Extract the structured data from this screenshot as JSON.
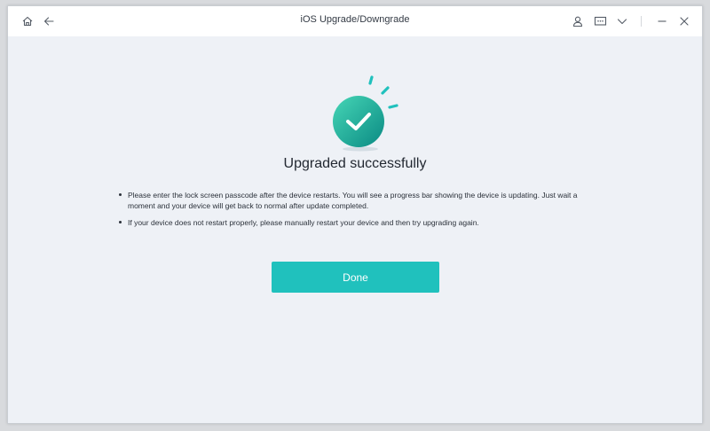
{
  "window": {
    "title": "iOS Upgrade/Downgrade"
  },
  "titlebar": {
    "left_icons": [
      "home-icon",
      "back-arrow-icon"
    ],
    "right_icons": [
      "user-icon",
      "feedback-icon",
      "chevron-down-icon",
      "minimize-icon",
      "close-icon"
    ]
  },
  "result": {
    "icon": "checkmark-icon",
    "heading": "Upgraded successfully",
    "notes": [
      "Please enter the lock screen passcode after the device restarts. You will see a progress bar showing the device is updating. Just wait a moment and your device will get back to normal after update completed.",
      "If your device does not restart properly, please manually restart your device and then try upgrading again."
    ],
    "done_label": "Done"
  },
  "colors": {
    "accent": "#20c1bd",
    "check_circle_light": "#3fd1b4",
    "check_circle_dark": "#0c8f86",
    "background": "#eef1f6",
    "titlebar": "#ffffff"
  }
}
